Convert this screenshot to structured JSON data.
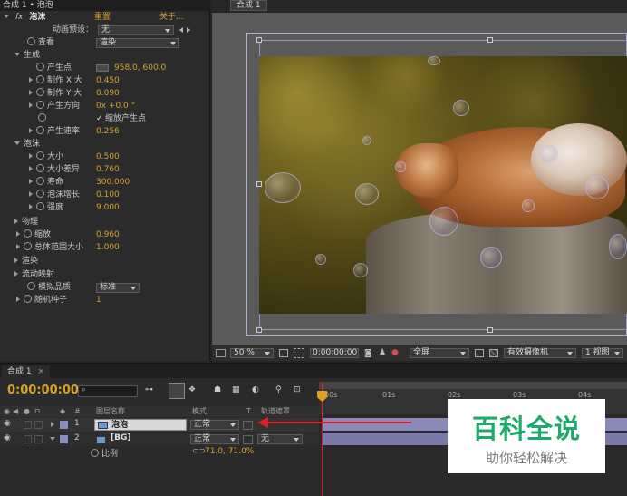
{
  "effect_panel": {
    "header": "合成 1 • 泡泡",
    "fx_name": "泡沫",
    "reset": "重置",
    "about": "关于...",
    "animation_preset_label": "动画预设：",
    "animation_preset_value": "无",
    "view_label": "查看",
    "view_value": "渲染",
    "sections": {
      "producer": "生成",
      "bubbles": "泡沫",
      "physics": "物理",
      "zoom": "缩放",
      "universe_size": "总体范围大小",
      "rendering": "渲染",
      "flow_map": "流动映射",
      "sim_quality": "模拟品质",
      "random_seed": "随机种子"
    },
    "producer_point_label": "产生点",
    "producer_point_value": "958.0, 600.0",
    "producer_x_label": "制作 X 大",
    "producer_x_value": "0.450",
    "producer_y_label": "制作 Y 大",
    "producer_y_value": "0.090",
    "producer_dir_label": "产生方向",
    "producer_dir_value": "0x +0.0 °",
    "zoom_producer_label": "缩放产生点",
    "production_rate_label": "产生速率",
    "production_rate_value": "0.256",
    "size_label": "大小",
    "size_value": "0.500",
    "size_var_label": "大小差异",
    "size_var_value": "0.760",
    "lifespan_label": "寿命",
    "lifespan_value": "300.000",
    "growth_label": "泡沫增长",
    "growth_value": "0.100",
    "strength_label": "强度",
    "strength_value": "9.000",
    "zoom_value": "0.960",
    "universe_value": "1.000",
    "sim_quality_value": "标准",
    "random_seed_value": "1"
  },
  "comp_panel": {
    "tab": "合成 1",
    "zoom": "50 %",
    "timecode": "0:00:00:00",
    "resolution": "全屏",
    "camera": "有效摄像机",
    "views": "1 视图"
  },
  "timeline": {
    "tab": "合成 1",
    "timecode": "0:00:00:00",
    "search_placeholder": "",
    "col_name": "图层名称",
    "col_mode": "模式",
    "col_t": "T",
    "col_trkmat": "轨道遮罩",
    "ruler": [
      "00s",
      "01s",
      "02s",
      "03s",
      "04s"
    ],
    "layers": [
      {
        "num": "1",
        "name": "泡泡",
        "mode": "正常",
        "trkmat": ""
      },
      {
        "num": "2",
        "name": "[BG]",
        "mode": "正常",
        "trkmat": "无"
      }
    ],
    "scale_label": "比例",
    "scale_value": "71.0, 71.0%"
  },
  "watermark": {
    "title": "百科全说",
    "subtitle": "助你轻松解决"
  },
  "colors": {
    "accent": "#d9a128",
    "playhead": "#e02020",
    "layer_bar": "#8a8ab8",
    "label_purple": "#8c8cc4"
  }
}
